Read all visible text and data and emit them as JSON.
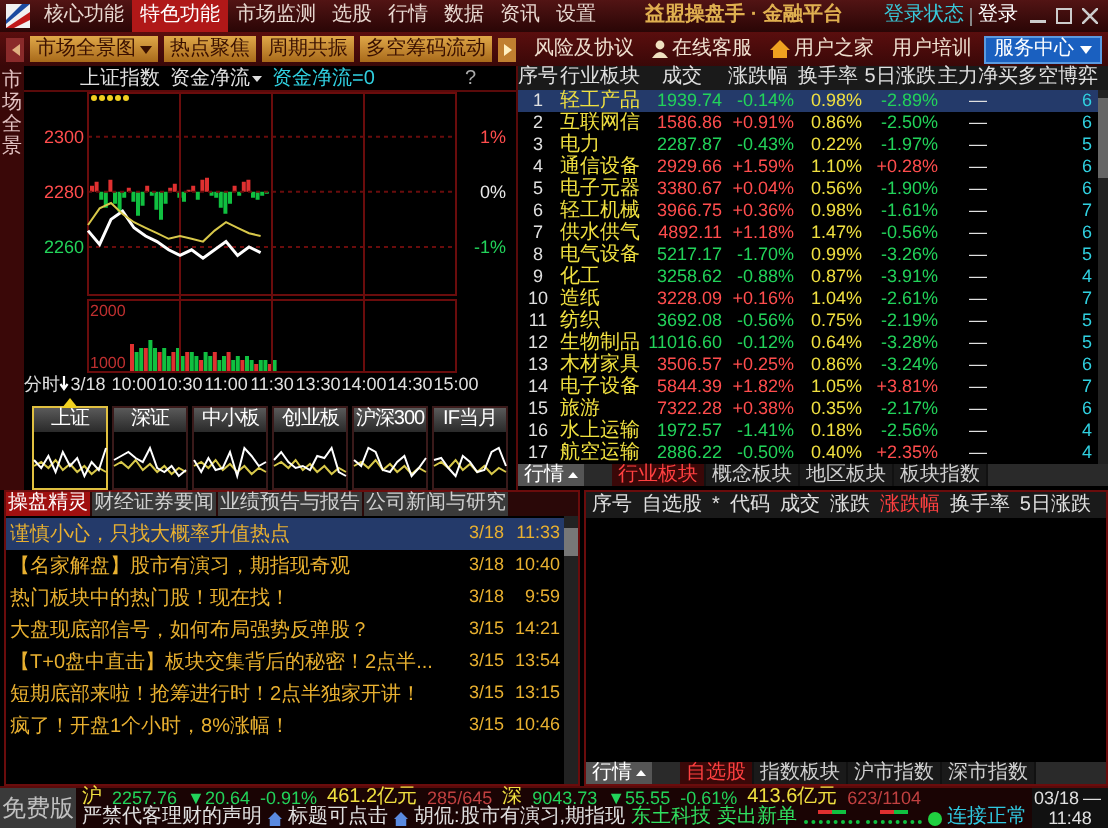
{
  "title_bar": {
    "menu": [
      {
        "label": "核心功能",
        "selected": false
      },
      {
        "label": "特色功能",
        "selected": true
      },
      {
        "label": "市场监测",
        "selected": false
      },
      {
        "label": "选股",
        "selected": false
      },
      {
        "label": "行情",
        "selected": false
      },
      {
        "label": "数据",
        "selected": false
      },
      {
        "label": "资讯",
        "selected": false
      },
      {
        "label": "设置",
        "selected": false
      }
    ],
    "title": "益盟操盘手 · 金融平台",
    "login_status": "登录状态",
    "login": "登录"
  },
  "toolbar": {
    "buttons": [
      {
        "label": "市场全景图",
        "dropdown": true
      },
      {
        "label": "热点聚焦",
        "dropdown": false
      },
      {
        "label": "周期共振",
        "dropdown": false
      },
      {
        "label": "多空筹码流动",
        "dropdown": false
      }
    ],
    "links": [
      {
        "label": "风险及协议",
        "kind": "plain"
      },
      {
        "label": "在线客服",
        "kind": "support"
      },
      {
        "label": "用户之家",
        "kind": "home"
      },
      {
        "label": "用户培训",
        "kind": "plain"
      }
    ],
    "service_button": "服务中心"
  },
  "side_tab": "市场全景",
  "chart": {
    "index_name": "上证指数",
    "indicator": "资金净流",
    "indicator_value": "资金净流=0",
    "help": "?",
    "period": "分时",
    "price_labels": [
      {
        "color": "#ff4d4d"
      },
      {
        "color": "#ff4d4d"
      },
      {
        "color": "#22d35a"
      }
    ],
    "percent_labels": [
      {
        "text": "1%",
        "color": "#ff4d4d"
      },
      {
        "text": "0%",
        "color": "#e8e8e8"
      },
      {
        "text": "-1%",
        "color": "#22d35a"
      }
    ],
    "volume_labels": [
      "2000",
      "1000"
    ],
    "chart_data": {
      "type": "line",
      "categories": [
        "3/18",
        null,
        null,
        null,
        "10:00",
        null,
        null,
        null,
        "10:30",
        null,
        null,
        null,
        "11:00",
        null,
        null,
        null,
        "11:30",
        null,
        null,
        null,
        "13:30",
        null,
        null,
        null,
        "14:00",
        null,
        null,
        null,
        "14:30",
        null,
        null,
        null,
        "15:00"
      ],
      "ylim": [
        2243,
        2314
      ],
      "yticks": [
        2300,
        2280,
        2260
      ],
      "grid": true,
      "series": [
        {
          "color": "#ffffff",
          "values": [
            2266,
            2261,
            2270,
            2273,
            2267,
            2264,
            2262,
            2259,
            2257,
            2259,
            2256,
            2259,
            2262,
            2257,
            2260,
            2258,
            null,
            null,
            null,
            null,
            null,
            null,
            null,
            null,
            null,
            null,
            null,
            null,
            null,
            null,
            null,
            null,
            null
          ]
        },
        {
          "color": "#d8c84a",
          "values": [
            2268,
            2274,
            2276,
            2272,
            2269,
            2267,
            2265,
            2263,
            2264,
            2263,
            2262,
            2266,
            2269,
            2267,
            2265,
            2264,
            null,
            null,
            null,
            null,
            null,
            null,
            null,
            null,
            null,
            null,
            null,
            null,
            null,
            null,
            null,
            null,
            null
          ]
        }
      ]
    }
  },
  "mini_charts": [
    {
      "label": "上证",
      "selected": true
    },
    {
      "label": "深证",
      "selected": false
    },
    {
      "label": "中小板",
      "selected": false
    },
    {
      "label": "创业板",
      "selected": false
    },
    {
      "label": "沪深300",
      "selected": false
    },
    {
      "label": "IF当月",
      "selected": false
    }
  ],
  "sector_table": {
    "columns": [
      "序号",
      "行业板块",
      "成交",
      "涨跌幅",
      "换手率",
      "5日涨跌",
      "主力净买",
      "多空博弈"
    ],
    "rows": [
      {
        "no": "1",
        "name": "轻工产品",
        "price": "1939.74",
        "change": "-0.14%",
        "up": false,
        "turnover": "0.98%",
        "five_day": "-2.89%",
        "five_day_up": false,
        "net_buy": "—",
        "score": "6",
        "selected": true
      },
      {
        "no": "2",
        "name": "互联网信",
        "price": "1586.86",
        "change": "+0.91%",
        "up": true,
        "turnover": "0.86%",
        "five_day": "-2.50%",
        "five_day_up": false,
        "net_buy": "—",
        "score": "6",
        "selected": false
      },
      {
        "no": "3",
        "name": "电力",
        "price": "2287.87",
        "change": "-0.43%",
        "up": false,
        "turnover": "0.22%",
        "five_day": "-1.97%",
        "five_day_up": false,
        "net_buy": "—",
        "score": "5",
        "selected": false
      },
      {
        "no": "4",
        "name": "通信设备",
        "price": "2929.66",
        "change": "+1.59%",
        "up": true,
        "turnover": "1.10%",
        "five_day": "+0.28%",
        "five_day_up": true,
        "net_buy": "—",
        "score": "6",
        "selected": false
      },
      {
        "no": "5",
        "name": "电子元器",
        "price": "3380.67",
        "change": "+0.04%",
        "up": true,
        "turnover": "0.56%",
        "five_day": "-1.90%",
        "five_day_up": false,
        "net_buy": "—",
        "score": "6",
        "selected": false
      },
      {
        "no": "6",
        "name": "轻工机械",
        "price": "3966.75",
        "change": "+0.36%",
        "up": true,
        "turnover": "0.98%",
        "five_day": "-1.61%",
        "five_day_up": false,
        "net_buy": "—",
        "score": "7",
        "selected": false
      },
      {
        "no": "7",
        "name": "供水供气",
        "price": "4892.11",
        "change": "+1.18%",
        "up": true,
        "turnover": "1.47%",
        "five_day": "-0.56%",
        "five_day_up": false,
        "net_buy": "—",
        "score": "6",
        "selected": false
      },
      {
        "no": "8",
        "name": "电气设备",
        "price": "5217.17",
        "change": "-1.70%",
        "up": false,
        "turnover": "0.99%",
        "five_day": "-3.26%",
        "five_day_up": false,
        "net_buy": "—",
        "score": "5",
        "selected": false
      },
      {
        "no": "9",
        "name": "化工",
        "price": "3258.62",
        "change": "-0.88%",
        "up": false,
        "turnover": "0.87%",
        "five_day": "-3.91%",
        "five_day_up": false,
        "net_buy": "—",
        "score": "4",
        "selected": false
      },
      {
        "no": "10",
        "name": "造纸",
        "price": "3228.09",
        "change": "+0.16%",
        "up": true,
        "turnover": "1.04%",
        "five_day": "-2.61%",
        "five_day_up": false,
        "net_buy": "—",
        "score": "7",
        "selected": false
      },
      {
        "no": "11",
        "name": "纺织",
        "price": "3692.08",
        "change": "-0.56%",
        "up": false,
        "turnover": "0.75%",
        "five_day": "-2.19%",
        "five_day_up": false,
        "net_buy": "—",
        "score": "5",
        "selected": false
      },
      {
        "no": "12",
        "name": "生物制品",
        "price": "11016.60",
        "change": "-0.12%",
        "up": false,
        "turnover": "0.64%",
        "five_day": "-3.28%",
        "five_day_up": false,
        "net_buy": "—",
        "score": "5",
        "selected": false
      },
      {
        "no": "13",
        "name": "木材家具",
        "price": "3506.57",
        "change": "+0.25%",
        "up": true,
        "turnover": "0.86%",
        "five_day": "-3.24%",
        "five_day_up": false,
        "net_buy": "—",
        "score": "6",
        "selected": false
      },
      {
        "no": "14",
        "name": "电子设备",
        "price": "5844.39",
        "change": "+1.82%",
        "up": true,
        "turnover": "1.05%",
        "five_day": "+3.81%",
        "five_day_up": true,
        "net_buy": "—",
        "score": "7",
        "selected": false
      },
      {
        "no": "15",
        "name": "旅游",
        "price": "7322.28",
        "change": "+0.38%",
        "up": true,
        "turnover": "0.35%",
        "five_day": "-2.17%",
        "five_day_up": false,
        "net_buy": "—",
        "score": "6",
        "selected": false
      },
      {
        "no": "16",
        "name": "水上运输",
        "price": "1972.57",
        "change": "-1.41%",
        "up": false,
        "turnover": "0.18%",
        "five_day": "-2.56%",
        "five_day_up": false,
        "net_buy": "—",
        "score": "4",
        "selected": false
      },
      {
        "no": "17",
        "name": "航空运输",
        "price": "2886.22",
        "change": "-0.50%",
        "up": false,
        "turnover": "0.40%",
        "five_day": "+2.35%",
        "five_day_up": true,
        "net_buy": "—",
        "score": "4",
        "selected": false
      }
    ],
    "market_button": "行情",
    "tabs": [
      {
        "label": "行业板块",
        "selected": true
      },
      {
        "label": "概念板块",
        "selected": false
      },
      {
        "label": "地区板块",
        "selected": false
      },
      {
        "label": "板块指数",
        "selected": false
      }
    ]
  },
  "news": {
    "tabs": [
      {
        "label": "操盘精灵",
        "selected": true
      },
      {
        "label": "财经证券要闻",
        "selected": false
      },
      {
        "label": "业绩预告与报告",
        "selected": false
      },
      {
        "label": "公司新闻与研究",
        "selected": false
      }
    ],
    "items": [
      {
        "title": "谨慎小心，只找大概率升值热点",
        "date": "3/18",
        "time": "11:33",
        "selected": true
      },
      {
        "title": "【名家解盘】股市有演习，期指现奇观",
        "date": "3/18",
        "time": "10:40",
        "selected": false
      },
      {
        "title": "热门板块中的热门股！现在找！",
        "date": "3/18",
        "time": "9:59",
        "selected": false
      },
      {
        "title": "大盘现底部信号，如何布局强势反弹股？",
        "date": "3/15",
        "time": "14:21",
        "selected": false
      },
      {
        "title": "【T+0盘中直击】板块交集背后的秘密！2点半...",
        "date": "3/15",
        "time": "13:54",
        "selected": false
      },
      {
        "title": "短期底部来啦！抢筹进行时！2点半独家开讲！",
        "date": "3/15",
        "time": "13:15",
        "selected": false
      },
      {
        "title": "疯了！开盘1个小时，8%涨幅！",
        "date": "3/15",
        "time": "10:46",
        "selected": false
      }
    ]
  },
  "watchlist": {
    "columns": [
      {
        "label": "序号",
        "highlighted": false
      },
      {
        "label": "自选股",
        "highlighted": false
      },
      {
        "label": "*",
        "highlighted": false
      },
      {
        "label": "代码",
        "highlighted": false
      },
      {
        "label": "成交",
        "highlighted": false
      },
      {
        "label": "涨跌",
        "highlighted": false
      },
      {
        "label": "涨跌幅",
        "highlighted": true
      },
      {
        "label": "换手率",
        "highlighted": false
      },
      {
        "label": "5日涨跌",
        "highlighted": false
      }
    ],
    "market_button": "行情",
    "tabs": [
      {
        "label": "自选股",
        "selected": true
      },
      {
        "label": "指数板块",
        "selected": false
      },
      {
        "label": "沪市指数",
        "selected": false
      },
      {
        "label": "深市指数",
        "selected": false
      }
    ]
  },
  "status_bar": {
    "edition": "免费版",
    "markets": [
      {
        "name": "沪",
        "value": "2257.76",
        "change": "▼20.64",
        "percent": "-0.91%",
        "up": false,
        "amount": "461.2亿元",
        "breadth": "285/645"
      },
      {
        "name": "深",
        "value": "9043.73",
        "change": "▼55.55",
        "percent": "-0.61%",
        "up": false,
        "amount": "413.6亿元",
        "breadth": "623/1104"
      }
    ],
    "date": "03/18",
    "dash": "—",
    "disclaimer": "严禁代客理财的声明",
    "hint": "标题可点击",
    "headline": "胡侃:股市有演习,期指现",
    "alert_stock": "东土科技",
    "alert_action": "卖出新单",
    "connected": true,
    "connection": "连接正常",
    "time": "11:48"
  }
}
